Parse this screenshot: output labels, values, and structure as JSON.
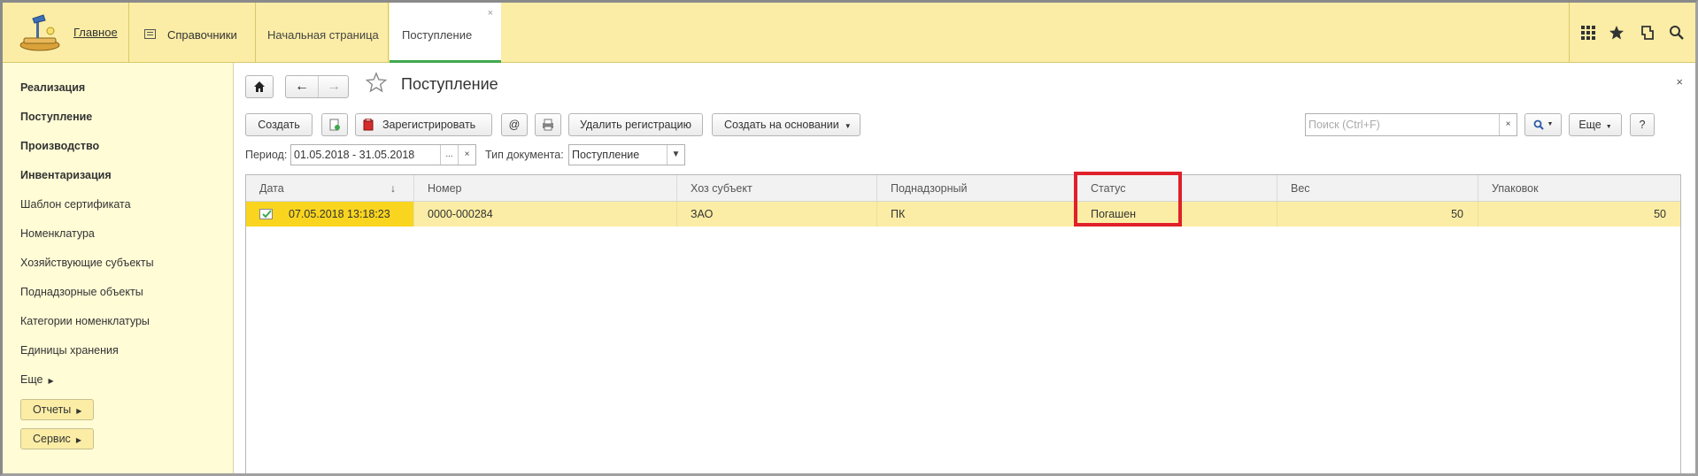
{
  "topbar": {
    "home_label": "Главное",
    "handbooks_label": "Справочники",
    "tabs": [
      {
        "label": "Начальная страница"
      },
      {
        "label": "Поступление",
        "close": "×"
      }
    ],
    "icons": [
      "apps-grid-icon",
      "star-icon",
      "history-icon",
      "search-icon"
    ]
  },
  "left_panel": {
    "items": [
      {
        "label": "Реализация"
      },
      {
        "label": "Поступление"
      },
      {
        "label": "Производство"
      },
      {
        "label": "Инвентаризация"
      },
      {
        "label": "Шаблон сертификата"
      },
      {
        "label": "Номенклатура"
      },
      {
        "label": "Хозяйствующие субъекты"
      },
      {
        "label": "Поднадзорные объекты"
      },
      {
        "label": "Категории номенклатуры"
      },
      {
        "label": "Единицы хранения"
      },
      {
        "label": "Еще"
      }
    ],
    "buttons": [
      {
        "label": "Отчеты"
      },
      {
        "label": "Сервис"
      }
    ]
  },
  "main": {
    "title": "Поступление",
    "close": "×",
    "toolbar": {
      "create": "Создать",
      "register": "Зарегистрировать",
      "at": "@",
      "delete_registration": "Удалить регистрацию",
      "create_based_on": "Создать на основании",
      "search_placeholder": "Поиск (Ctrl+F)",
      "search_clear": "×",
      "more": "Еще",
      "help": "?"
    },
    "filters": {
      "period_label": "Период:",
      "period_value": "01.05.2018 - 31.05.2018",
      "period_btn": "...",
      "period_clear": "×",
      "doctype_label": "Тип документа:",
      "doctype_value": "Поступление"
    },
    "table": {
      "columns": [
        "Дата",
        "Номер",
        "Хоз субъект",
        "Поднадзорный",
        "Статус",
        "Вес",
        "Упаковок"
      ],
      "sort_indicator": "↓",
      "rows": [
        {
          "date": "07.05.2018 13:18:23",
          "number": "0000-000284",
          "subject": "ЗАО",
          "supervised": "ПК",
          "status": "Погашен",
          "weight": "50",
          "packages": "50"
        }
      ]
    }
  },
  "colors": {
    "topbar_bg": "#fbeda5",
    "left_panel_bg": "#fffcd6",
    "row_highlight": "#fbeda5",
    "row_selected_cell": "#f9d51f",
    "active_tab_underline": "#3fa84e",
    "status_highlight_box": "#e0202a"
  }
}
